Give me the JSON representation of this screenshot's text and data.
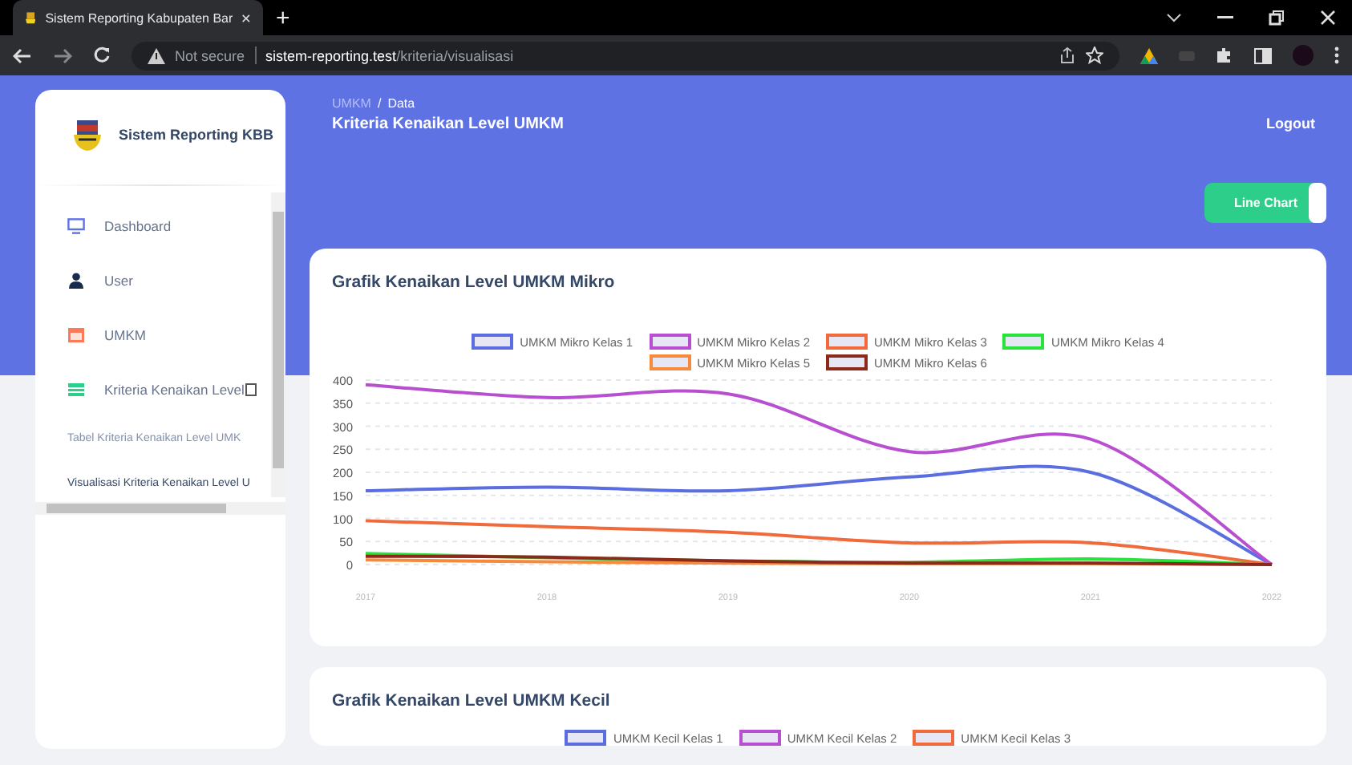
{
  "browser": {
    "tab_title": "Sistem Reporting Kabupaten Bar",
    "new_tab": "+",
    "security": "Not secure",
    "url_host": "sistem-reporting.test",
    "url_path": "/kriteria/visualisasi"
  },
  "sidebar": {
    "brand": "Sistem Reporting KBB",
    "items": [
      {
        "label": "Dashboard",
        "selected": false
      },
      {
        "label": "User",
        "selected": false
      },
      {
        "label": "UMKM",
        "selected": false
      },
      {
        "label": "Kriteria Kenaikan Level",
        "selected": false,
        "expanded": true,
        "children": [
          {
            "label": "Tabel Kriteria Kenaikan Level UMK",
            "selected": false
          },
          {
            "label": "Visualisasi Kriteria Kenaikan Level U",
            "selected": true
          }
        ]
      }
    ]
  },
  "header": {
    "breadcrumb": [
      "UMKM",
      "Data"
    ],
    "separator": "/",
    "title": "Kriteria Kenaikan Level UMKM",
    "logout": "Logout",
    "toggle": {
      "label": "Line Chart",
      "on": true
    }
  },
  "cards": [
    {
      "title": "Grafik Kenaikan Level UMKM Mikro",
      "chart_data": {
        "type": "line",
        "grid": true,
        "x": [
          "2017",
          "2018",
          "2019",
          "2020",
          "2021",
          "2022"
        ],
        "ylim": [
          0,
          400
        ],
        "yticks": [
          0,
          50,
          100,
          150,
          200,
          250,
          300,
          350,
          400
        ],
        "series": [
          {
            "name": "UMKM Mikro Kelas 1",
            "color": "#5b6ee0",
            "values": [
              160,
              168,
              160,
              190,
              200,
              0
            ]
          },
          {
            "name": "UMKM Mikro Kelas 2",
            "color": "#b84fd0",
            "values": [
              390,
              362,
              370,
              245,
              272,
              0
            ]
          },
          {
            "name": "UMKM Mikro Kelas 3",
            "color": "#f06a3c",
            "values": [
              95,
              82,
              70,
              47,
              47,
              0
            ]
          },
          {
            "name": "UMKM Mikro Kelas 4",
            "color": "#27e33a",
            "values": [
              24,
              15,
              8,
              5,
              12,
              0
            ]
          },
          {
            "name": "UMKM Mikro Kelas 5",
            "color": "#f5893c",
            "values": [
              10,
              6,
              3,
              2,
              2,
              0
            ]
          },
          {
            "name": "UMKM Mikro Kelas 6",
            "color": "#8b2a1a",
            "values": [
              18,
              16,
              8,
              3,
              3,
              0
            ]
          }
        ]
      }
    },
    {
      "title": "Grafik Kenaikan Level UMKM Kecil",
      "legend": [
        {
          "name": "UMKM Kecil Kelas 1",
          "color": "#5b6ee0"
        },
        {
          "name": "UMKM Kecil Kelas 2",
          "color": "#b84fd0"
        },
        {
          "name": "UMKM Kecil Kelas 3",
          "color": "#f06a3c"
        }
      ]
    }
  ]
}
